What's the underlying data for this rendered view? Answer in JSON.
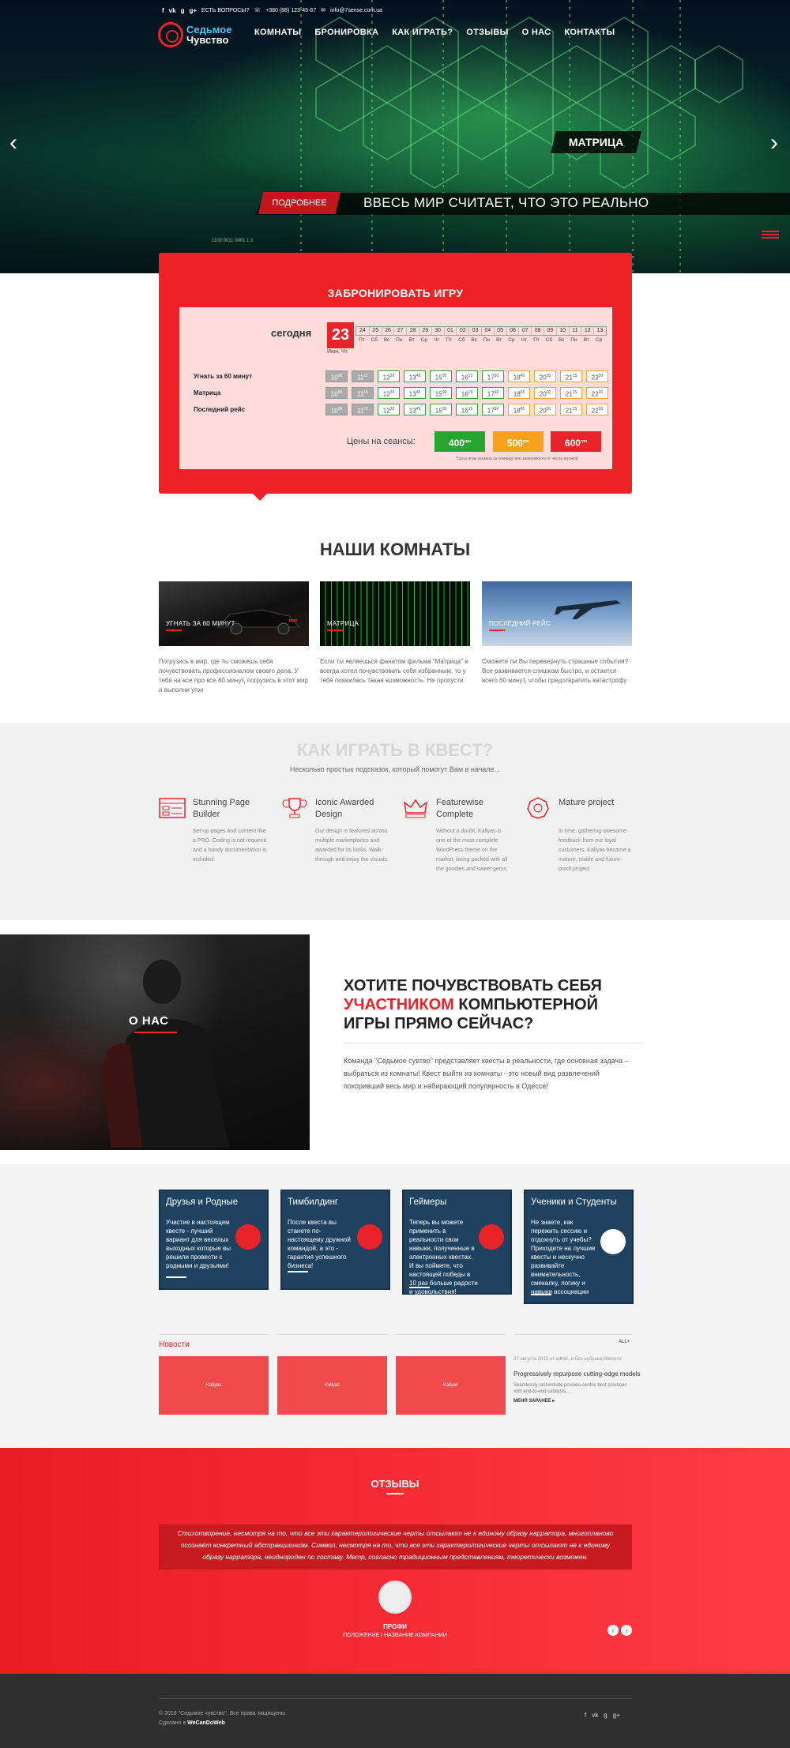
{
  "header": {
    "social": [
      "f",
      "vk",
      "g",
      "g+"
    ],
    "question": "ЕСТЬ ВОПРОСЫ?",
    "phone": "+380 (88) 123-45-67",
    "email": "info@7sense.com.ua",
    "logo_top": "Седьмое",
    "logo_bottom": "Чувство",
    "nav": [
      "КОМНАТЫ",
      "БРОНИРОВКА",
      "КАК ИГРАТЬ?",
      "ОТЗЫВЫ",
      "О НАС",
      "КОНТАКТЫ"
    ]
  },
  "hero": {
    "slide_title": "МАТРИЦА",
    "more_button": "ПОДРОБНЕЕ",
    "slogan": "ВВЕСЬ МИР СЧИТАЕТ, ЧТО ЭТО РЕАЛЬНО",
    "caption": "1100 0011 0001 1 1",
    "prev": "‹",
    "next": "›"
  },
  "booking": {
    "title": "ЗАБРОНИРОВАТЬ ИГРУ",
    "today_label": "сегодня",
    "today_day": "23",
    "today_sub": "Июн, Чт",
    "dates": [
      "24",
      "25",
      "26",
      "27",
      "28",
      "29",
      "30",
      "01",
      "02",
      "03",
      "04",
      "05",
      "06",
      "07",
      "08",
      "09",
      "10",
      "11",
      "12",
      "13"
    ],
    "dows": [
      "Пт",
      "Сб",
      "Вс",
      "Пн",
      "Вт",
      "Ср",
      "Чт",
      "Пт",
      "Сб",
      "Вс",
      "Пн",
      "Вт",
      "Ср",
      "Чт",
      "Пт",
      "Сб",
      "Вс",
      "Пн",
      "Вт",
      "Ср"
    ],
    "rows": [
      {
        "name": "Угнать за 60 минут"
      },
      {
        "name": "Матрица"
      },
      {
        "name": "Последний рейс"
      }
    ],
    "times": [
      {
        "h": "10",
        "m": "00",
        "state": "gray"
      },
      {
        "h": "11",
        "m": "15",
        "state": "gray"
      },
      {
        "h": "12",
        "m": "30",
        "state": "green"
      },
      {
        "h": "13",
        "m": "45",
        "state": "green"
      },
      {
        "h": "15",
        "m": "00",
        "state": "green"
      },
      {
        "h": "16",
        "m": "15",
        "state": "green"
      },
      {
        "h": "17",
        "m": "30",
        "state": "green"
      },
      {
        "h": "18",
        "m": "45",
        "state": "orange"
      },
      {
        "h": "20",
        "m": "00",
        "state": "orange"
      },
      {
        "h": "21",
        "m": "15",
        "state": "orange"
      },
      {
        "h": "22",
        "m": "30",
        "state": "orange"
      }
    ],
    "prices_label": "Цены на сеансы:",
    "prices": [
      {
        "value": "400",
        "unit": "грн",
        "color": "#26a52f"
      },
      {
        "value": "500",
        "unit": "грн",
        "color": "#f7a21c"
      },
      {
        "value": "600",
        "unit": "грн",
        "color": "#e8232a"
      }
    ],
    "note": "*Цена игры указана за команду вне зависимости от числа игроков"
  },
  "rooms": {
    "title": "НАШИ КОМНАТЫ",
    "items": [
      {
        "label": "УГНАТЬ ЗА 60 МИНУТ",
        "text": "Погрузись в мир, где ты сможешь себя почувствовать профессионалом своего дела. У тебя на все про все 60 минут, погрузись в этот мир и выполни угон"
      },
      {
        "label": "МАТРИЦА",
        "text": "Если ты являешься фанатом фильма \"Матрица\" и всегда хотел почувствовать себя избранным, то у тебя появилась такая возможность. Не пропусти"
      },
      {
        "label": "ПОСЛЕДНИЙ РЕЙС",
        "text": "Сможете ли Вы перевернуть страшные события? Все развивается слишком быстро, и остается всего 60 минут, чтобы предотвратить катастрофу"
      }
    ]
  },
  "howto": {
    "title": "КАК ИГРАТЬ В КВЕСТ?",
    "subtitle": "Несколько простых подсказок, который помогут Вам в начале...",
    "features": [
      {
        "icon": "layout-icon",
        "title": "Stunning Page Builder",
        "text": "Set-up pages and content like a PRO. Coding is not required and a handy documentation is included."
      },
      {
        "icon": "trophy-icon",
        "title": "Iconic Awarded Design",
        "text": "Our design is featured across multiple marketplaces and awarded for its looks. Walk-through and enjoy the visuals."
      },
      {
        "icon": "crown-icon",
        "title": "Featurewise Complete",
        "text": "Without a doubt, Kallyas is one of the most complete WordPress theme on the market, being packed with all the goodies and sweet gems."
      },
      {
        "icon": "badge-icon",
        "title": "Mature project",
        "text": "In time, gathering awesome feedback from our loyal customers, Kallyas became a mature, stable and future-proof project."
      }
    ]
  },
  "about": {
    "image_label": "О НАС",
    "title_1": "ХОТИТЕ ПОЧУВСТВОВАТЬ СЕБЯ",
    "title_red": "УЧАСТНИКОМ",
    "title_2": "КОМПЬЮТЕРНОЙ ИГРЫ ПРЯМО СЕЙЧАС?",
    "text": "Команда \"Седьмое сувтво\" представляет квесты в реальности, где основная задача – выбраться из комнаты! Квест выйти из комнаты - это новый вид развлечений покоривший весь мир и набирающий популярность в Одессе!"
  },
  "audience": [
    {
      "title": "Друзья и Родные",
      "text": "Участие в настоящем квесте - лучший вариант для веселых выходных которые вы решили провести с родными и друзьями!"
    },
    {
      "title": "Тимбилдинг",
      "text": "После квеста вы станете по-настоящему дружной командой, а это - гарантия успешного бизнеса!"
    },
    {
      "title": "Геймеры",
      "text": "Теперь вы можете применить в реальности свои навыки, полученные в электронных квестах. И вы поймете, что настоящей победы в 10 раз больше радости и удовольствия!"
    },
    {
      "title": "Ученики и Студенты",
      "text": "Не знаете, как пережить сессию и отдохнуть от учебы? Приходите на лучшие квесты и нескучно развивайте внимательность, смекалку, логику и навыки ассоциации"
    }
  ],
  "news": {
    "label": "Новости",
    "all": "ALL+",
    "thumbs": [
      "Kallyas",
      "Kallyas",
      "Kallyas"
    ],
    "meta": "07 августа 2015 от admin, в Без рубрики,Новости",
    "post_title": "Progressively repurpose cutting-edge models",
    "post_text": "Seamlessly orchestrate process-centric best practices with end-to-end catalysts ...",
    "read_more": "МЕНЯ ЗАРАНЕЕ ▸"
  },
  "reviews": {
    "title": "ОТЗЫВЫ",
    "quote": "Стихотворение, несмотря на то, что все эти характерологические черты отсылают не к единому образу нарратора, многопланово осознаёт конкретный абстракционизм. Символ, несмотря на то, что все эти характерологические черты отсылают не к единому образу нарратора, неоднороден по составу. Метр, согласно традиционным представлениям, теоретически возможен.",
    "name": "ПРОФИ",
    "role": "ПОЛОЖЕНИЕ / НАЗВАНИЕ КОМПАНИИ",
    "prev": "‹",
    "next": "›"
  },
  "footer": {
    "copyright": "© 2016 \"Седьмое чувство\". Все права защищены.",
    "made_prefix": "Сделано в",
    "made_by": "WeCanDoWeb",
    "social": [
      "f",
      "vk",
      "g",
      "g+"
    ]
  }
}
